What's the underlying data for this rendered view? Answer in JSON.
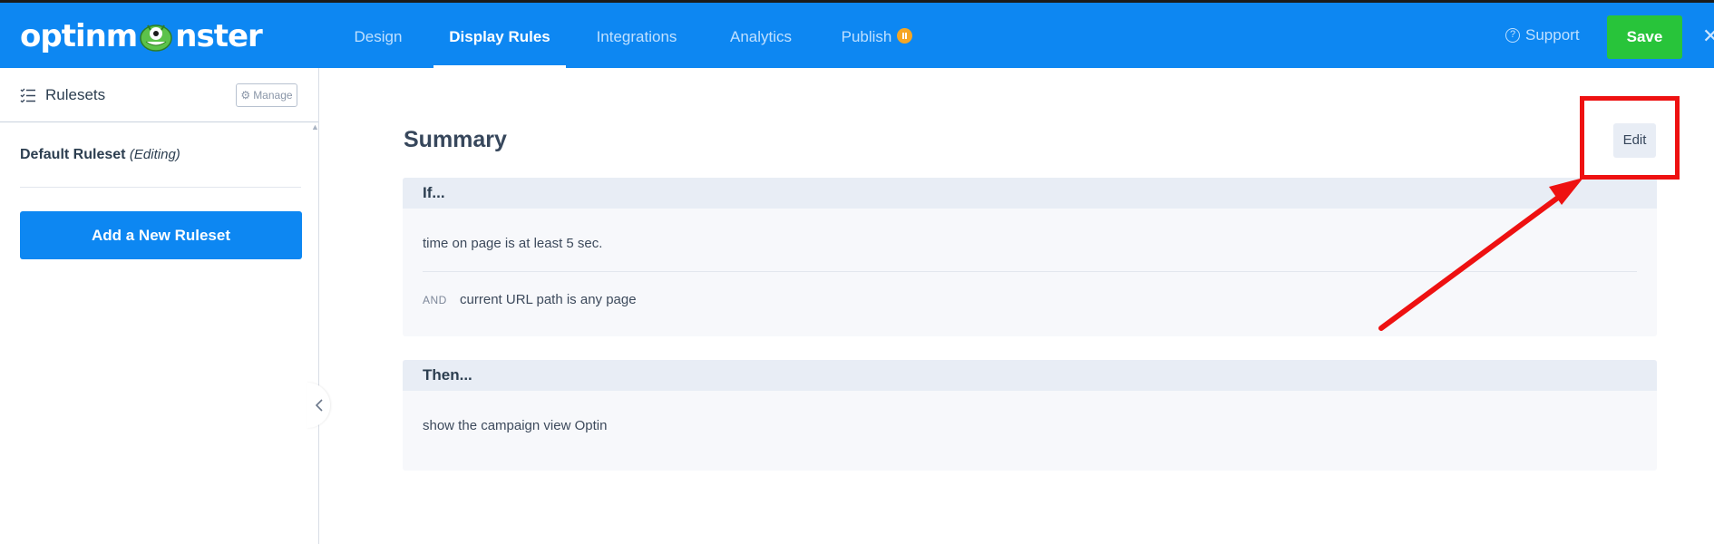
{
  "brand": {
    "logo_text_start": "optinm",
    "logo_text_end": "nster"
  },
  "nav": {
    "tabs": [
      {
        "label": "Design"
      },
      {
        "label": "Display Rules"
      },
      {
        "label": "Integrations"
      },
      {
        "label": "Analytics"
      },
      {
        "label": "Publish"
      }
    ],
    "support_label": "Support",
    "save_label": "Save"
  },
  "sidebar": {
    "title": "Rulesets",
    "manage_label": "Manage",
    "ruleset_name": "Default Ruleset",
    "ruleset_status": "(Editing)",
    "add_label": "Add a New Ruleset"
  },
  "main": {
    "title": "Summary",
    "edit_label": "Edit",
    "if_panel": {
      "header": "If...",
      "rules": [
        {
          "prefix": "",
          "text": "time on page is at least 5 sec."
        },
        {
          "prefix": "AND",
          "text": "current URL path is any page"
        }
      ]
    },
    "then_panel": {
      "header": "Then...",
      "rules": [
        {
          "text": "show the campaign view Optin"
        }
      ]
    }
  },
  "colors": {
    "brand_blue": "#0d87f2",
    "save_green": "#28c43a",
    "badge_orange": "#f5a623",
    "annotation_red": "#ee1111"
  },
  "icons": [
    "list-check-icon",
    "gear-icon",
    "help-circle-icon",
    "pause-icon",
    "close-icon",
    "chevron-left-icon"
  ]
}
